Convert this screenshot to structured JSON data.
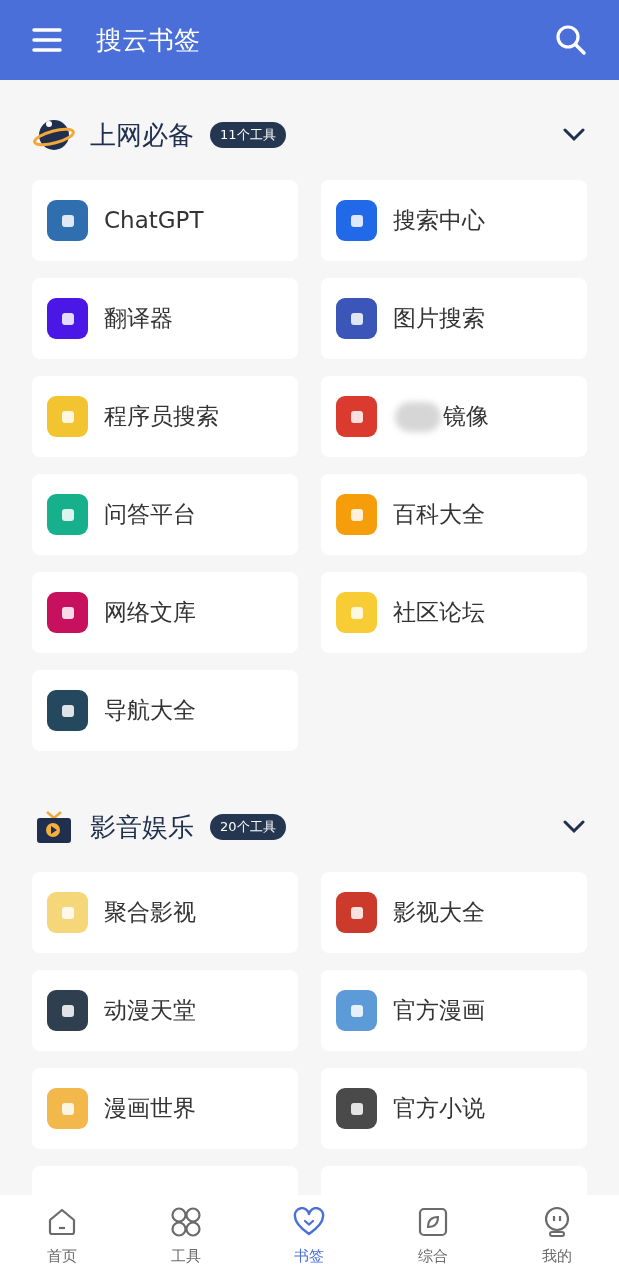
{
  "app_bar": {
    "title": "搜云书签"
  },
  "sections": [
    {
      "kind": "planet",
      "title": "上网必备",
      "badge": "11个工具",
      "expanded": true,
      "items": [
        {
          "label": "ChatGPT",
          "color": "#2f6fb0",
          "masked": false
        },
        {
          "label": "搜索中心",
          "color": "#2169e8",
          "masked": false
        },
        {
          "label": "翻译器",
          "color": "#4a17e6",
          "masked": false
        },
        {
          "label": "图片搜索",
          "color": "#3b56b8",
          "masked": false
        },
        {
          "label": "程序员搜索",
          "color": "#f2c530",
          "masked": false
        },
        {
          "label": "镜像",
          "color": "#db3a2f",
          "masked": true
        },
        {
          "label": "问答平台",
          "color": "#17b08c",
          "masked": false
        },
        {
          "label": "百科大全",
          "color": "#f59d0a",
          "masked": false
        },
        {
          "label": "网络文库",
          "color": "#c8115e",
          "masked": false
        },
        {
          "label": "社区论坛",
          "color": "#f7cc35",
          "masked": false
        },
        {
          "label": "导航大全",
          "color": "#24495e",
          "masked": false
        }
      ]
    },
    {
      "kind": "tv",
      "title": "影音娱乐",
      "badge": "20个工具",
      "expanded": true,
      "items": [
        {
          "label": "聚合影视",
          "color": "#f5d77a",
          "masked": false
        },
        {
          "label": "影视大全",
          "color": "#cc3a2c",
          "masked": false
        },
        {
          "label": "动漫天堂",
          "color": "#2f3f4f",
          "masked": false
        },
        {
          "label": "官方漫画",
          "color": "#5d9ad8",
          "masked": false
        },
        {
          "label": "漫画世界",
          "color": "#f2b84b",
          "masked": false
        },
        {
          "label": "官方小说",
          "color": "#4a4a4a",
          "masked": false
        }
      ],
      "more_below": true
    }
  ],
  "nav": [
    {
      "kind": "home",
      "label": "首页",
      "selected": false
    },
    {
      "kind": "grid",
      "label": "工具",
      "selected": false
    },
    {
      "kind": "heart",
      "label": "书签",
      "selected": true
    },
    {
      "kind": "compass",
      "label": "综合",
      "selected": false
    },
    {
      "kind": "robot",
      "label": "我的",
      "selected": false
    }
  ]
}
